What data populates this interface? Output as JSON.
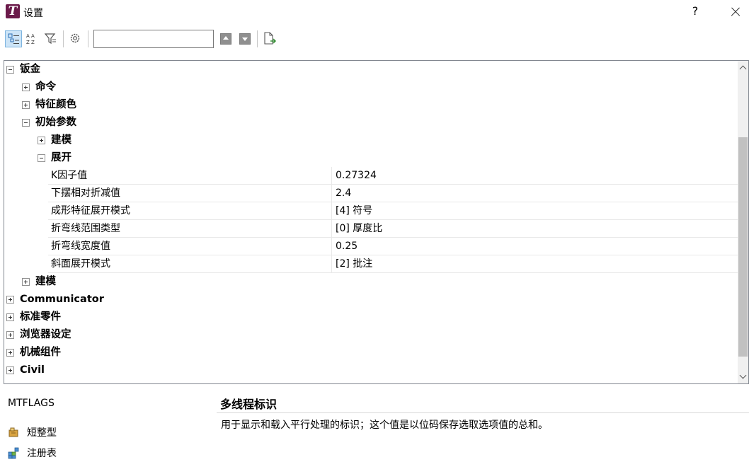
{
  "window": {
    "title": "设置",
    "help_label": "?"
  },
  "toolbar": {
    "search": {
      "value": "",
      "placeholder": ""
    },
    "buttons": [
      "categorized-view",
      "alphabetical-view",
      "filter",
      "settings",
      "previous",
      "next",
      "export"
    ]
  },
  "tree": {
    "root_sheetmetal": "钣金",
    "commands": "命令",
    "feature_colors": "特征颜色",
    "initial_params": "初始参数",
    "modeling_sub": "建模",
    "unfold": "展开",
    "properties": [
      {
        "name": "K因子值",
        "value": "0.27324"
      },
      {
        "name": "下摆相对折减值",
        "value": "2.4"
      },
      {
        "name": "成形特征展开模式",
        "value": "[4] 符号"
      },
      {
        "name": "折弯线范围类型",
        "value": "[0] 厚度比"
      },
      {
        "name": "折弯线宽度值",
        "value": "0.25"
      },
      {
        "name": "斜面展开模式",
        "value": "[2] 批注"
      }
    ],
    "modeling": "建模",
    "communicator": "Communicator",
    "standard_parts": "标准零件",
    "browser_settings": "浏览器设定",
    "mechanical_assembly": "机械组件",
    "civil": "Civil"
  },
  "info": {
    "variable_name": "MTFLAGS",
    "title": "多线程标识",
    "description": "用于显示和载入平行处理的标识；这个值是以位码保存选取选项值的总和。",
    "type_label": "短整型",
    "storage_label": "注册表"
  },
  "colors": {
    "selected_button_bg": "#cce4f7",
    "logo_bg": "#6b1a4a"
  }
}
